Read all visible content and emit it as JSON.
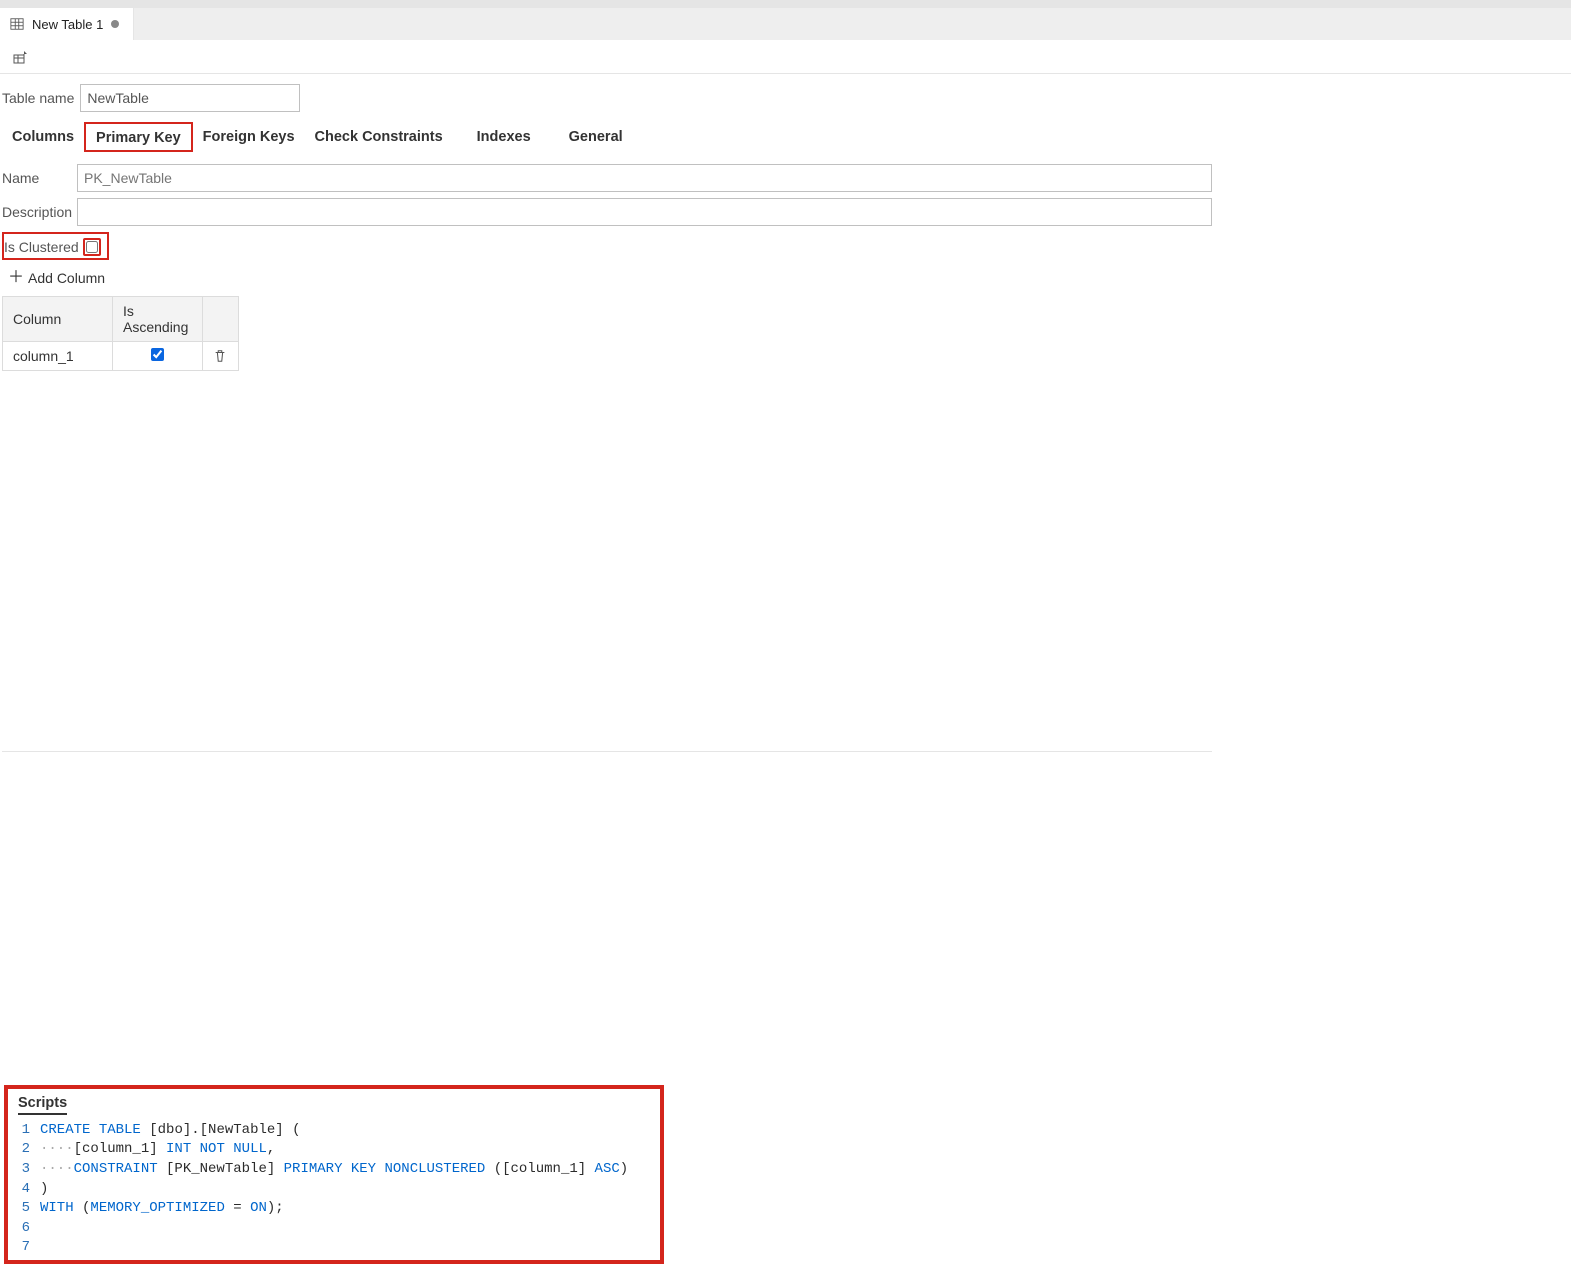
{
  "tab": {
    "label": "New Table 1"
  },
  "labels": {
    "table_name": "Table name",
    "name": "Name",
    "description": "Description",
    "is_clustered": "Is Clustered",
    "add_column": "Add Column",
    "scripts": "Scripts"
  },
  "table_name_value": "NewTable",
  "tabs_nav": {
    "columns": "Columns",
    "primary_key": "Primary Key",
    "foreign_keys": "Foreign Keys",
    "check_constraints": "Check Constraints",
    "indexes": "Indexes",
    "general": "General",
    "active": "primary_key"
  },
  "primary_key": {
    "name_value": "",
    "name_placeholder": "PK_NewTable",
    "description_value": "",
    "is_clustered_checked": false
  },
  "pk_table": {
    "headers": {
      "column": "Column",
      "is_ascending": "Is Ascending"
    },
    "rows": [
      {
        "column": "column_1",
        "is_ascending": true
      }
    ]
  },
  "script": {
    "lines": [
      {
        "n": 1,
        "tokens": [
          {
            "t": "CREATE",
            "c": "kw"
          },
          {
            "t": " ",
            "c": "tok"
          },
          {
            "t": "TABLE",
            "c": "kw"
          },
          {
            "t": " ",
            "c": "tok"
          },
          {
            "t": "[dbo].[NewTable] (",
            "c": "tok"
          }
        ]
      },
      {
        "n": 2,
        "tokens": [
          {
            "t": "····",
            "c": "gray"
          },
          {
            "t": "[column_1] ",
            "c": "tok"
          },
          {
            "t": "INT",
            "c": "kw"
          },
          {
            "t": " ",
            "c": "tok"
          },
          {
            "t": "NOT",
            "c": "kw"
          },
          {
            "t": " ",
            "c": "tok"
          },
          {
            "t": "NULL",
            "c": "kw"
          },
          {
            "t": ",",
            "c": "tok"
          }
        ]
      },
      {
        "n": 3,
        "tokens": [
          {
            "t": "····",
            "c": "gray"
          },
          {
            "t": "CONSTRAINT",
            "c": "kw"
          },
          {
            "t": " [PK_NewTable] ",
            "c": "tok"
          },
          {
            "t": "PRIMARY",
            "c": "kw"
          },
          {
            "t": " ",
            "c": "tok"
          },
          {
            "t": "KEY",
            "c": "kw"
          },
          {
            "t": " ",
            "c": "tok"
          },
          {
            "t": "NONCLUSTERED",
            "c": "kw"
          },
          {
            "t": " ([column_1] ",
            "c": "tok"
          },
          {
            "t": "ASC",
            "c": "kw"
          },
          {
            "t": ")",
            "c": "tok"
          }
        ]
      },
      {
        "n": 4,
        "tokens": [
          {
            "t": ")",
            "c": "tok"
          }
        ]
      },
      {
        "n": 5,
        "tokens": [
          {
            "t": "WITH",
            "c": "kw"
          },
          {
            "t": " (",
            "c": "tok"
          },
          {
            "t": "MEMORY_OPTIMIZED",
            "c": "kw"
          },
          {
            "t": " = ",
            "c": "tok"
          },
          {
            "t": "ON",
            "c": "kw"
          },
          {
            "t": ");",
            "c": "tok"
          }
        ]
      },
      {
        "n": 6,
        "tokens": []
      },
      {
        "n": 7,
        "tokens": []
      }
    ]
  }
}
